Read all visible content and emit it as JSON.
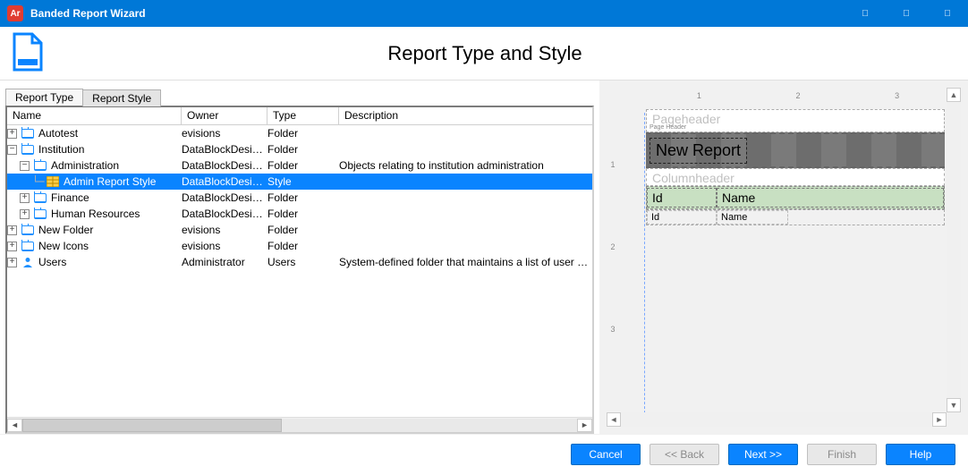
{
  "window": {
    "title": "Banded Report Wizard"
  },
  "header": {
    "page_title": "Report Type and Style"
  },
  "tabs": {
    "report_type": "Report Type",
    "report_style": "Report Style"
  },
  "columns": {
    "name": "Name",
    "owner": "Owner",
    "type": "Type",
    "description": "Description"
  },
  "tree": {
    "autotest": {
      "name": "Autotest",
      "owner": "evisions",
      "type": "Folder",
      "desc": ""
    },
    "institution": {
      "name": "Institution",
      "owner": "DataBlockDesig...",
      "type": "Folder",
      "desc": ""
    },
    "administration": {
      "name": "Administration",
      "owner": "DataBlockDesig...",
      "type": "Folder",
      "desc": "Objects relating to institution administration"
    },
    "adminstyle": {
      "name": "Admin Report Style",
      "owner": "DataBlockDesig...",
      "type": "Style",
      "desc": ""
    },
    "finance": {
      "name": "Finance",
      "owner": "DataBlockDesig...",
      "type": "Folder",
      "desc": ""
    },
    "hr": {
      "name": "Human Resources",
      "owner": "DataBlockDesig...",
      "type": "Folder",
      "desc": ""
    },
    "newfolder": {
      "name": "New Folder",
      "owner": "evisions",
      "type": "Folder",
      "desc": ""
    },
    "newicons": {
      "name": "New Icons",
      "owner": "evisions",
      "type": "Folder",
      "desc": ""
    },
    "users": {
      "name": "Users",
      "owner": "Administrator",
      "type": "Users",
      "desc": "System-defined folder that maintains a list of user folders"
    }
  },
  "preview": {
    "ruler_h": {
      "m1": "1",
      "m2": "2",
      "m3": "3"
    },
    "ruler_v": {
      "m1": "1",
      "m2": "2",
      "m3": "3"
    },
    "pageheader_label": "Pageheader",
    "pageheader_tiny": "Page Header",
    "title_field": "New Report",
    "columnheader_label": "Columnheader",
    "col_id": "Id",
    "col_name": "Name",
    "det_id": "Id",
    "det_name": "Name"
  },
  "buttons": {
    "cancel": "Cancel",
    "back": "<< Back",
    "next": "Next >>",
    "finish": "Finish",
    "help": "Help"
  }
}
